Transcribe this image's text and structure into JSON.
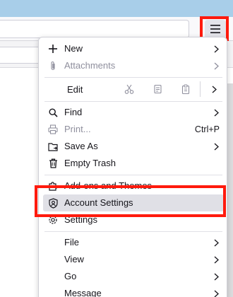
{
  "menu": {
    "items": [
      {
        "label": "New",
        "icon": "plus-icon"
      },
      {
        "label": "Attachments",
        "icon": "paperclip-icon"
      },
      {
        "label": "Edit"
      },
      {
        "label": "Find",
        "icon": "search-icon"
      },
      {
        "label": "Print...",
        "icon": "printer-icon",
        "shortcut": "Ctrl+P"
      },
      {
        "label": "Save As",
        "icon": "save-as-icon"
      },
      {
        "label": "Empty Trash",
        "icon": "trash-icon"
      },
      {
        "label": "Add-ons and Themes",
        "icon": "puzzle-icon"
      },
      {
        "label": "Account Settings",
        "icon": "account-settings-icon"
      },
      {
        "label": "Settings",
        "icon": "gear-icon"
      },
      {
        "label": "File"
      },
      {
        "label": "View"
      },
      {
        "label": "Go"
      },
      {
        "label": "Message"
      }
    ]
  },
  "colors": {
    "highlight": "#ff1a0d",
    "titlebar": "#a8cee9"
  }
}
